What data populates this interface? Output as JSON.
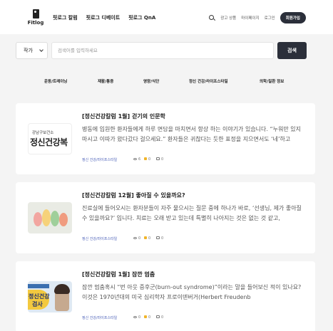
{
  "header": {
    "logo_text": "Fitlog",
    "nav": [
      "핏로그 칼럼",
      "핏로그 디베이트",
      "핏로그 QnA"
    ],
    "links": [
      "광고 상품",
      "마이페이지",
      "로그인"
    ],
    "signup": "회원가입"
  },
  "search": {
    "select_value": "작가",
    "placeholder": "검색어를 입력하세요",
    "button": "검색"
  },
  "categories": [
    "운동/트레이닝",
    "재활/통증",
    "영양/식단",
    "정신 건강/라이프스타일",
    "의학/질환 정보"
  ],
  "articles": [
    {
      "title": "[정신건강칼럼 1월] 걷기의 인문학",
      "excerpt": "병동에 입원한 환자들에게 하루 면담을 마치면서 항상 하는 이야기가 있습니다. “누워만 있지 마시고 이따가 왔다갔다 걸으세요.” 환자들은 귀찮다는 듯한 표정을 지으면서도 ‘네’하고",
      "category": "정신 건강/라이프스타일",
      "views": "6",
      "likes": "0",
      "comments": "0",
      "thumb_text_small": "강남구보건소",
      "thumb_text_big": "정신건강복"
    },
    {
      "title": "[정신건강칼럼 12월] 좋아질 수 있을까요?",
      "excerpt": "진료실에 들어오시는 환자분들이 자주 물으시는 질문 중에 하나가 바로, ‘선생님, 제가 좋아질 수 있을까요?’ 입니다. 치료는 오래 받고 있는데 특별히 나아지는 것은 없는 것 같고,",
      "category": "정신 건강/라이프스타일",
      "views": "0",
      "likes": "0",
      "comments": "0"
    },
    {
      "title": "[정신건강칼럼 1월] 잠깐 멈춤",
      "excerpt": "잠깐 멈춤혹시 “번 아웃 증후군(burn-out syndrome)”이라는 말을 들어보신 적이 있나요? 이것은 1970년대의 미국 심리학자 프로이덴버거(Herbert Freudenb",
      "category": "정신 건강/라이프스타일",
      "views": "0",
      "likes": "0",
      "comments": "0",
      "thumb_text_1": "정신건강",
      "thumb_text_2": "검사"
    }
  ],
  "colors": {
    "dark": "#2b2f3a",
    "accent_link": "#4a5fb8",
    "background": "#f4f4f4"
  },
  "icons": [
    "search-icon",
    "eye-icon",
    "like-icon",
    "comment-icon",
    "chevron-down-icon"
  ]
}
